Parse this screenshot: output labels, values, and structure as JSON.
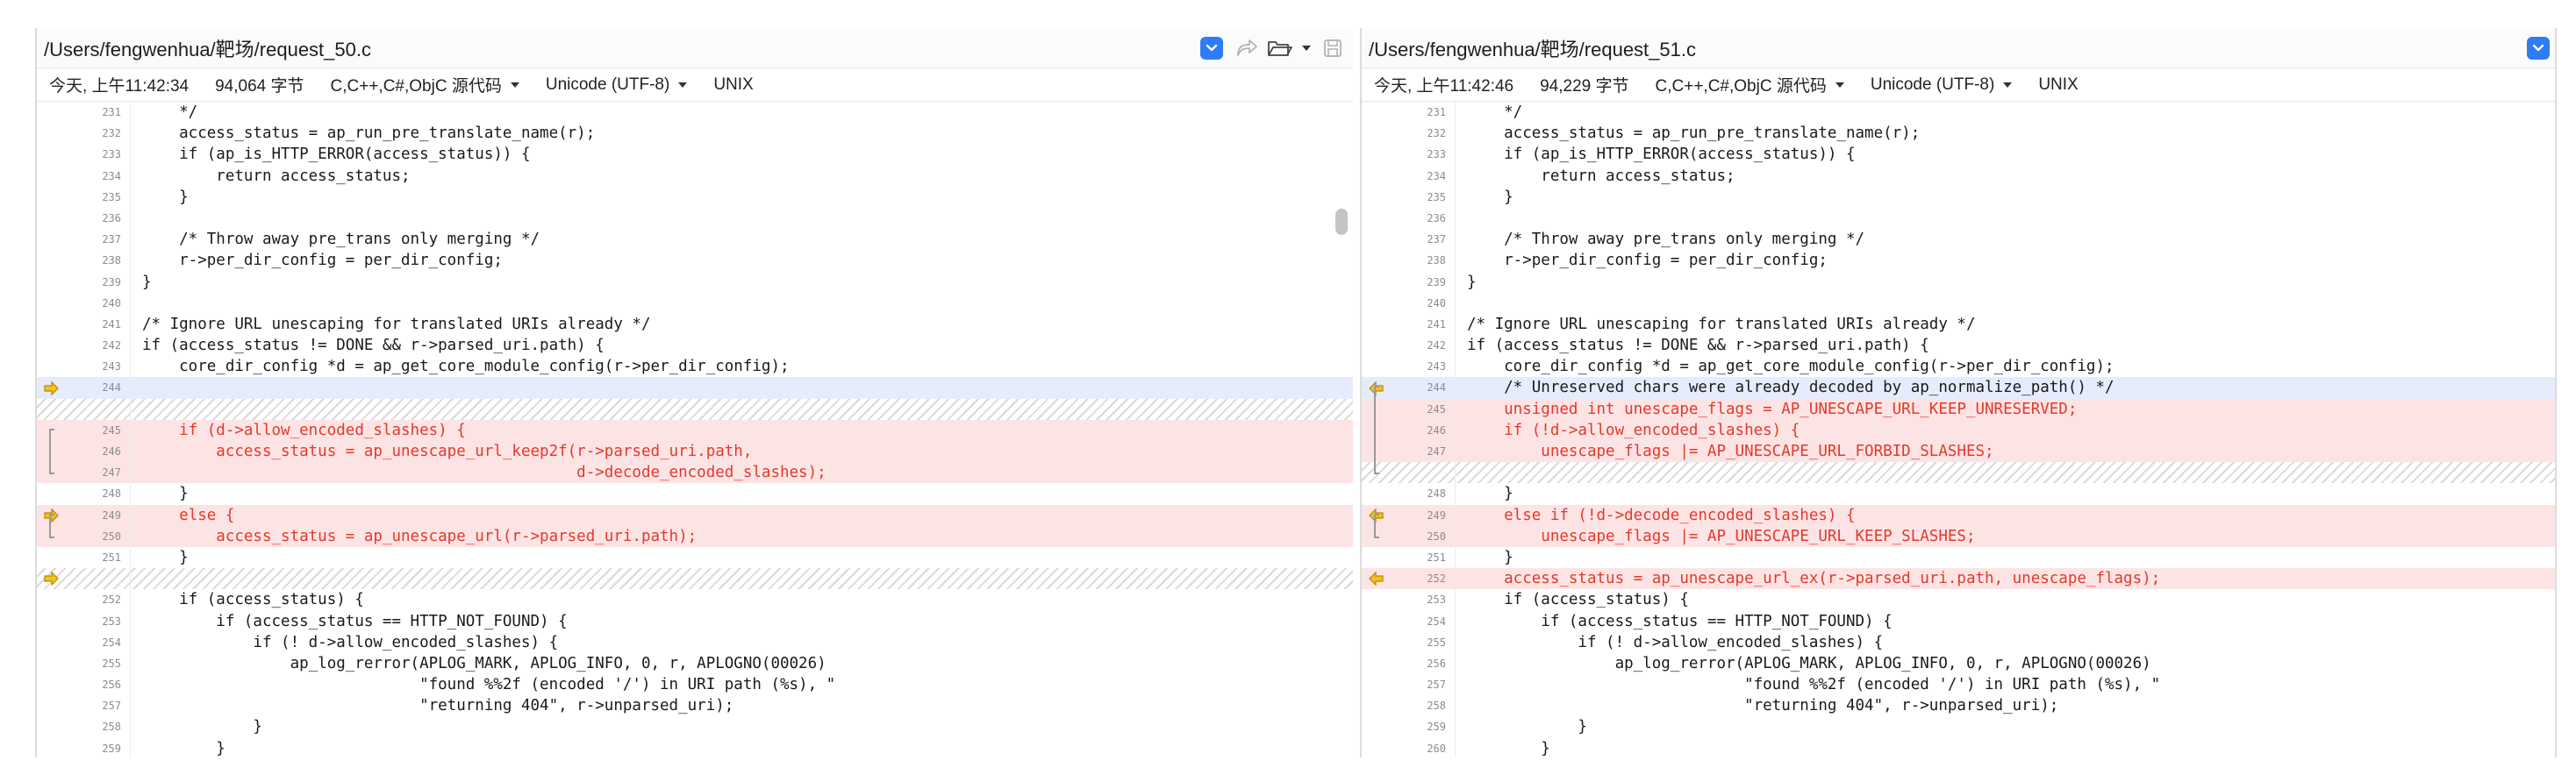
{
  "left": {
    "path": "/Users/fengwenhua/靶场/request_50.c",
    "info": {
      "time": "今天, 上午11:42:34",
      "size": "94,064 字节",
      "lang": "C,C++,C#,ObjC 源代码",
      "encoding": "Unicode (UTF-8)",
      "line_ending": "UNIX"
    },
    "lines": [
      {
        "num": "231",
        "text": "    */",
        "state": "normal"
      },
      {
        "num": "232",
        "text": "    access_status = ap_run_pre_translate_name(r);",
        "state": "normal"
      },
      {
        "num": "233",
        "text": "    if (ap_is_HTTP_ERROR(access_status)) {",
        "state": "normal"
      },
      {
        "num": "234",
        "text": "        return access_status;",
        "state": "normal"
      },
      {
        "num": "235",
        "text": "    }",
        "state": "normal"
      },
      {
        "num": "236",
        "text": "",
        "state": "normal"
      },
      {
        "num": "237",
        "text": "    /* Throw away pre_trans only merging */",
        "state": "normal"
      },
      {
        "num": "238",
        "text": "    r->per_dir_config = per_dir_config;",
        "state": "normal"
      },
      {
        "num": "239",
        "text": "}",
        "state": "normal"
      },
      {
        "num": "240",
        "text": "",
        "state": "normal"
      },
      {
        "num": "241",
        "text": "/* Ignore URL unescaping for translated URIs already */",
        "state": "normal"
      },
      {
        "num": "242",
        "text": "if (access_status != DONE && r->parsed_uri.path) {",
        "state": "normal"
      },
      {
        "num": "243",
        "text": "    core_dir_config *d = ap_get_core_module_config(r->per_dir_config);",
        "state": "normal"
      },
      {
        "num": "244",
        "text": "",
        "state": "current"
      },
      {
        "num": "",
        "text": "",
        "state": "filler"
      },
      {
        "num": "245",
        "text": "    if (d->allow_encoded_slashes) {",
        "state": "changed"
      },
      {
        "num": "246",
        "text": "        access_status = ap_unescape_url_keep2f(r->parsed_uri.path,",
        "state": "changed"
      },
      {
        "num": "247",
        "text": "                                               d->decode_encoded_slashes);",
        "state": "changed"
      },
      {
        "num": "248",
        "text": "    }",
        "state": "normal"
      },
      {
        "num": "249",
        "text": "    else {",
        "state": "changed"
      },
      {
        "num": "250",
        "text": "        access_status = ap_unescape_url(r->parsed_uri.path);",
        "state": "changed"
      },
      {
        "num": "251",
        "text": "    }",
        "state": "normal"
      },
      {
        "num": "",
        "text": "",
        "state": "filler"
      },
      {
        "num": "252",
        "text": "    if (access_status) {",
        "state": "normal"
      },
      {
        "num": "253",
        "text": "        if (access_status == HTTP_NOT_FOUND) {",
        "state": "normal"
      },
      {
        "num": "254",
        "text": "            if (! d->allow_encoded_slashes) {",
        "state": "normal"
      },
      {
        "num": "255",
        "text": "                ap_log_rerror(APLOG_MARK, APLOG_INFO, 0, r, APLOGNO(00026)",
        "state": "normal"
      },
      {
        "num": "256",
        "text": "                              \"found %%2f (encoded '/') in URI path (%s), \"",
        "state": "normal"
      },
      {
        "num": "257",
        "text": "                              \"returning 404\", r->unparsed_uri);",
        "state": "normal"
      },
      {
        "num": "258",
        "text": "            }",
        "state": "normal"
      },
      {
        "num": "259",
        "text": "        }",
        "state": "normal"
      }
    ]
  },
  "right": {
    "path": "/Users/fengwenhua/靶场/request_51.c",
    "info": {
      "time": "今天, 上午11:42:46",
      "size": "94,229 字节",
      "lang": "C,C++,C#,ObjC 源代码",
      "encoding": "Unicode (UTF-8)",
      "line_ending": "UNIX"
    },
    "lines": [
      {
        "num": "231",
        "text": "    */",
        "state": "normal"
      },
      {
        "num": "232",
        "text": "    access_status = ap_run_pre_translate_name(r);",
        "state": "normal"
      },
      {
        "num": "233",
        "text": "    if (ap_is_HTTP_ERROR(access_status)) {",
        "state": "normal"
      },
      {
        "num": "234",
        "text": "        return access_status;",
        "state": "normal"
      },
      {
        "num": "235",
        "text": "    }",
        "state": "normal"
      },
      {
        "num": "236",
        "text": "",
        "state": "normal"
      },
      {
        "num": "237",
        "text": "    /* Throw away pre_trans only merging */",
        "state": "normal"
      },
      {
        "num": "238",
        "text": "    r->per_dir_config = per_dir_config;",
        "state": "normal"
      },
      {
        "num": "239",
        "text": "}",
        "state": "normal"
      },
      {
        "num": "240",
        "text": "",
        "state": "normal"
      },
      {
        "num": "241",
        "text": "/* Ignore URL unescaping for translated URIs already */",
        "state": "normal"
      },
      {
        "num": "242",
        "text": "if (access_status != DONE && r->parsed_uri.path) {",
        "state": "normal"
      },
      {
        "num": "243",
        "text": "    core_dir_config *d = ap_get_core_module_config(r->per_dir_config);",
        "state": "normal"
      },
      {
        "num": "244",
        "text": "    /* Unreserved chars were already decoded by ap_normalize_path() */",
        "state": "current"
      },
      {
        "num": "245",
        "text": "    unsigned int unescape_flags = AP_UNESCAPE_URL_KEEP_UNRESERVED;",
        "state": "changed"
      },
      {
        "num": "246",
        "text": "    if (!d->allow_encoded_slashes) {",
        "state": "changed"
      },
      {
        "num": "247",
        "text": "        unescape_flags |= AP_UNESCAPE_URL_FORBID_SLASHES;",
        "state": "changed"
      },
      {
        "num": "",
        "text": "",
        "state": "filler"
      },
      {
        "num": "248",
        "text": "    }",
        "state": "normal"
      },
      {
        "num": "249",
        "text": "    else if (!d->decode_encoded_slashes) {",
        "state": "changed"
      },
      {
        "num": "250",
        "text": "        unescape_flags |= AP_UNESCAPE_URL_KEEP_SLASHES;",
        "state": "changed"
      },
      {
        "num": "251",
        "text": "    }",
        "state": "normal"
      },
      {
        "num": "252",
        "text": "    access_status = ap_unescape_url_ex(r->parsed_uri.path, unescape_flags);",
        "state": "changed"
      },
      {
        "num": "253",
        "text": "    if (access_status) {",
        "state": "normal"
      },
      {
        "num": "254",
        "text": "        if (access_status == HTTP_NOT_FOUND) {",
        "state": "normal"
      },
      {
        "num": "255",
        "text": "            if (! d->allow_encoded_slashes) {",
        "state": "normal"
      },
      {
        "num": "256",
        "text": "                ap_log_rerror(APLOG_MARK, APLOG_INFO, 0, r, APLOGNO(00026)",
        "state": "normal"
      },
      {
        "num": "257",
        "text": "                              \"found %%2f (encoded '/') in URI path (%s), \"",
        "state": "normal"
      },
      {
        "num": "258",
        "text": "                              \"returning 404\", r->unparsed_uri);",
        "state": "normal"
      },
      {
        "num": "259",
        "text": "            }",
        "state": "normal"
      },
      {
        "num": "260",
        "text": "        }",
        "state": "normal"
      }
    ]
  },
  "colors": {
    "changed_bg": "#fde4e4",
    "current_bg": "#e6ecfb",
    "diff_text": "#e5382b",
    "accent": "#2e7cf6",
    "arrow": "#f2c318"
  },
  "icons": {
    "dropdown": "chevron-down-icon",
    "forward": "forward-arrow-icon",
    "open_folder": "folder-icon",
    "save": "save-icon",
    "diff_marker": "diff-arrow-icon"
  }
}
